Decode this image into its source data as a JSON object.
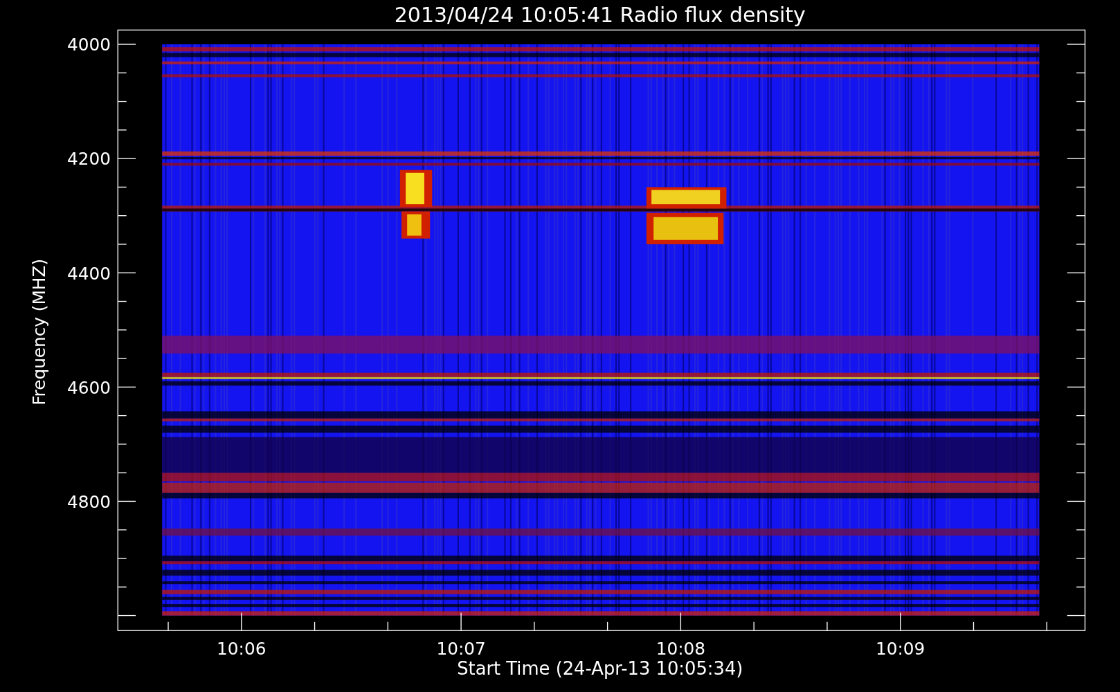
{
  "title": "2013/04/24 10:05:41 Radio flux density",
  "y_axis": {
    "label": "Frequency (MHZ)",
    "tick_labels": [
      "4000",
      "4200",
      "4400",
      "4600",
      "4800"
    ]
  },
  "x_axis": {
    "label": "Start Time (24-Apr-13 10:05:34)",
    "tick_labels": [
      "10:06",
      "10:07",
      "10:08",
      "10:09"
    ]
  }
}
